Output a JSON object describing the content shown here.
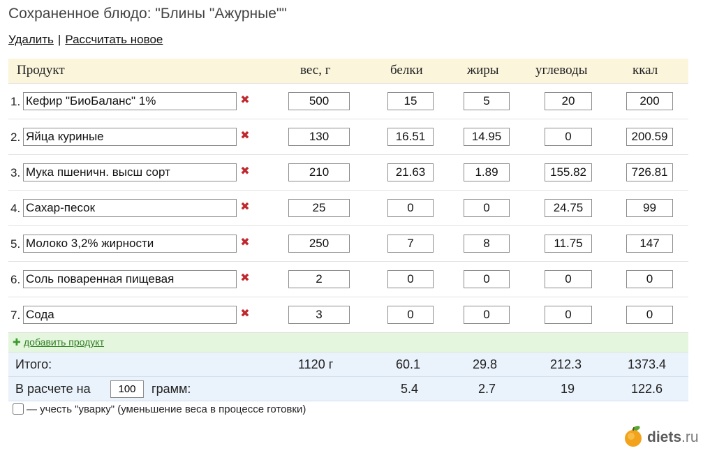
{
  "title": "Сохраненное блюдо: \"Блины \"Ажурные\"\"",
  "actions": {
    "delete": "Удалить",
    "separator": "|",
    "recalc": "Рассчитать новое"
  },
  "columns": {
    "product": "Продукт",
    "weight": "вес, г",
    "protein": "белки",
    "fat": "жиры",
    "carbs": "углеводы",
    "kcal": "ккал"
  },
  "rows": [
    {
      "num": "1.",
      "name": "Кефир \"БиоБаланс\" 1%",
      "weight": "500",
      "protein": "15",
      "fat": "5",
      "carbs": "20",
      "kcal": "200"
    },
    {
      "num": "2.",
      "name": "Яйца куриные",
      "weight": "130",
      "protein": "16.51",
      "fat": "14.95",
      "carbs": "0",
      "kcal": "200.59"
    },
    {
      "num": "3.",
      "name": "Мука пшеничн. высш сорт",
      "weight": "210",
      "protein": "21.63",
      "fat": "1.89",
      "carbs": "155.82",
      "kcal": "726.81"
    },
    {
      "num": "4.",
      "name": "Сахар-песок",
      "weight": "25",
      "protein": "0",
      "fat": "0",
      "carbs": "24.75",
      "kcal": "99"
    },
    {
      "num": "5.",
      "name": "Молоко 3,2% жирности",
      "weight": "250",
      "protein": "7",
      "fat": "8",
      "carbs": "11.75",
      "kcal": "147"
    },
    {
      "num": "6.",
      "name": "Соль поваренная пищевая",
      "weight": "2",
      "protein": "0",
      "fat": "0",
      "carbs": "0",
      "kcal": "0"
    },
    {
      "num": "7.",
      "name": "Сода",
      "weight": "3",
      "protein": "0",
      "fat": "0",
      "carbs": "0",
      "kcal": "0"
    }
  ],
  "add_product": "добавить продукт",
  "totals": {
    "label": "Итого:",
    "weight": "1120 г",
    "protein": "60.1",
    "fat": "29.8",
    "carbs": "212.3",
    "kcal": "1373.4"
  },
  "per": {
    "label_before": "В расчете на",
    "amount": "100",
    "label_after": "грамм:",
    "protein": "5.4",
    "fat": "2.7",
    "carbs": "19",
    "kcal": "122.6"
  },
  "boil_option": "— учесть \"уварку\" (уменьшение веса в процессе готовки)",
  "logo": {
    "name": "diets",
    "domain": ".ru"
  },
  "icons": {
    "delete": "delete-x-icon",
    "add": "plus-icon",
    "logo": "apple-icon"
  },
  "colors": {
    "header_bg": "#fbf5dc",
    "add_bg": "#e4f6dd",
    "totals_bg": "#eaf2fb",
    "delete": "#c0282d"
  }
}
